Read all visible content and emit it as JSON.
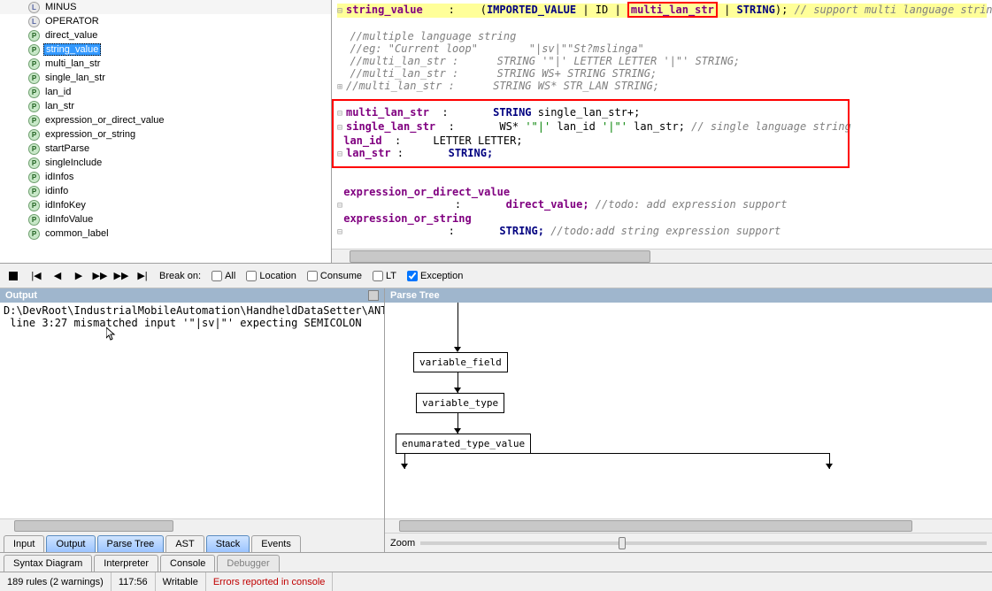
{
  "tree": {
    "items": [
      {
        "icon": "L",
        "label": "MINUS"
      },
      {
        "icon": "L",
        "label": "OPERATOR"
      },
      {
        "icon": "P",
        "label": "direct_value"
      },
      {
        "icon": "P",
        "label": "string_value",
        "selected": true
      },
      {
        "icon": "P",
        "label": "multi_lan_str"
      },
      {
        "icon": "P",
        "label": "single_lan_str"
      },
      {
        "icon": "P",
        "label": "lan_id"
      },
      {
        "icon": "P",
        "label": "lan_str"
      },
      {
        "icon": "P",
        "label": "expression_or_direct_value"
      },
      {
        "icon": "P",
        "label": "expression_or_string"
      },
      {
        "icon": "P",
        "label": "startParse"
      },
      {
        "icon": "P",
        "label": "singleInclude"
      },
      {
        "icon": "P",
        "label": "idInfos"
      },
      {
        "icon": "P",
        "label": "idinfo"
      },
      {
        "icon": "P",
        "label": "idInfoKey"
      },
      {
        "icon": "P",
        "label": "idInfoValue"
      },
      {
        "icon": "P",
        "label": "common_label"
      }
    ]
  },
  "code": {
    "l1_rule": "string_value",
    "l1_mid": "    :    (",
    "l1_iv": "IMPORTED_VALUE",
    "l1_id": " | ID ",
    "l1_mls": "multi_lan_str",
    "l1_str": "STRING",
    "l1_end": ");",
    "l1_cmt": " // support multi language string",
    "c1": "//multiple language string",
    "c2": "//eg: \"Current loop\"        \"|sv|\"\"St?mslinga\"",
    "c3": "//multi_lan_str :      STRING '\"|' LETTER LETTER '|\"' STRING;",
    "c4": "//multi_lan_str :      STRING WS+ STRING STRING;",
    "c5": "//multi_lan_str :      STRING WS* STR_LAN STRING;",
    "mr": "multi_lan_str",
    "mr2": "single_lan_str",
    "mr3": "lan_id",
    "mr4": "lan_str",
    "col": "  :       ",
    "mstr": "STRING",
    "m1t": " single_lan_str+;",
    "m2a": "WS* ",
    "m2b": "'\"|'",
    "m2c": " lan_id ",
    "m2d": "'|\"'",
    "m2e": " lan_str;",
    "m2cmt": " // single language string",
    "m3": "LETTER LETTER;",
    "m4": "STRING;",
    "er1": "expression_or_direct_value",
    "er1b": "                 :       ",
    "er1v": "direct_value;",
    "er1c": " //todo: add expression support",
    "er2": "expression_or_string",
    "er2b": "                :       ",
    "er2v": "STRING;",
    "er2c": " //todo:add string expression support"
  },
  "toolbar": {
    "break_on": "Break on:",
    "all": "All",
    "location": "Location",
    "consume": "Consume",
    "lt": "LT",
    "exception": "Exception"
  },
  "output": {
    "title": "Output",
    "l1": "D:\\DevRoot\\IndustrialMobileAutomation\\HandheldDataSetter\\ANT",
    "l2": " line 3:27 mismatched input '\"|sv|\"' expecting SEMICOLON"
  },
  "parsetree": {
    "title": "Parse Tree",
    "n1": "variable_field",
    "n2": "variable_type",
    "n3": "enumarated_type_value",
    "zoom": "Zoom"
  },
  "tabs": {
    "input": "Input",
    "output": "Output",
    "parsetree": "Parse Tree",
    "ast": "AST",
    "stack": "Stack",
    "events": "Events"
  },
  "bottom_tabs": {
    "syntax": "Syntax Diagram",
    "interp": "Interpreter",
    "console": "Console",
    "debugger": "Debugger"
  },
  "status": {
    "rules": "189 rules (2 warnings)",
    "pos": "117:56",
    "mode": "Writable",
    "err": "Errors reported in console"
  }
}
